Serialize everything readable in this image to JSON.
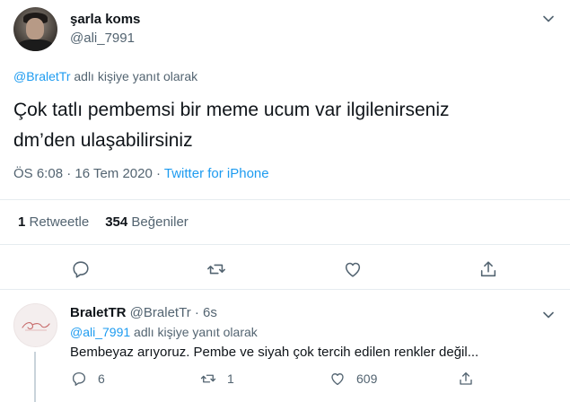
{
  "tweet": {
    "display_name": "şarla koms",
    "handle": "@ali_7991",
    "reply_mention": "@BraletTr",
    "reply_suffix": " adlı kişiye yanıt olarak",
    "text_line1": "Çok tatlı pembemsi bir meme ucum var ilgilenirseniz",
    "text_line2": "dm’den ulaşabilirsiniz",
    "time": "ÖS 6:08 · 16 Tem 2020 · ",
    "source": "Twitter for iPhone",
    "retweets_count": "1",
    "retweets_label": " Retweetle",
    "likes_count": "354",
    "likes_label": " Beğeniler"
  },
  "actions": {
    "reply_icon": "reply-icon",
    "retweet_icon": "retweet-icon",
    "like_icon": "heart-icon",
    "share_icon": "share-icon"
  },
  "reply": {
    "display_name": "BraletTR",
    "handle_time": " @BraletTr · 6s",
    "reply_mention": "@ali_7991",
    "reply_suffix": " adlı kişiye yanıt olarak",
    "text": "Bembeyaz arıyoruz. Pembe ve siyah çok tercih edilen renkler değil...",
    "reply_count": "6",
    "retweet_count": "1",
    "like_count": "609"
  },
  "colors": {
    "accent": "#1d9bf0",
    "secondary_text": "#536471",
    "divider": "#e6ecf0"
  }
}
